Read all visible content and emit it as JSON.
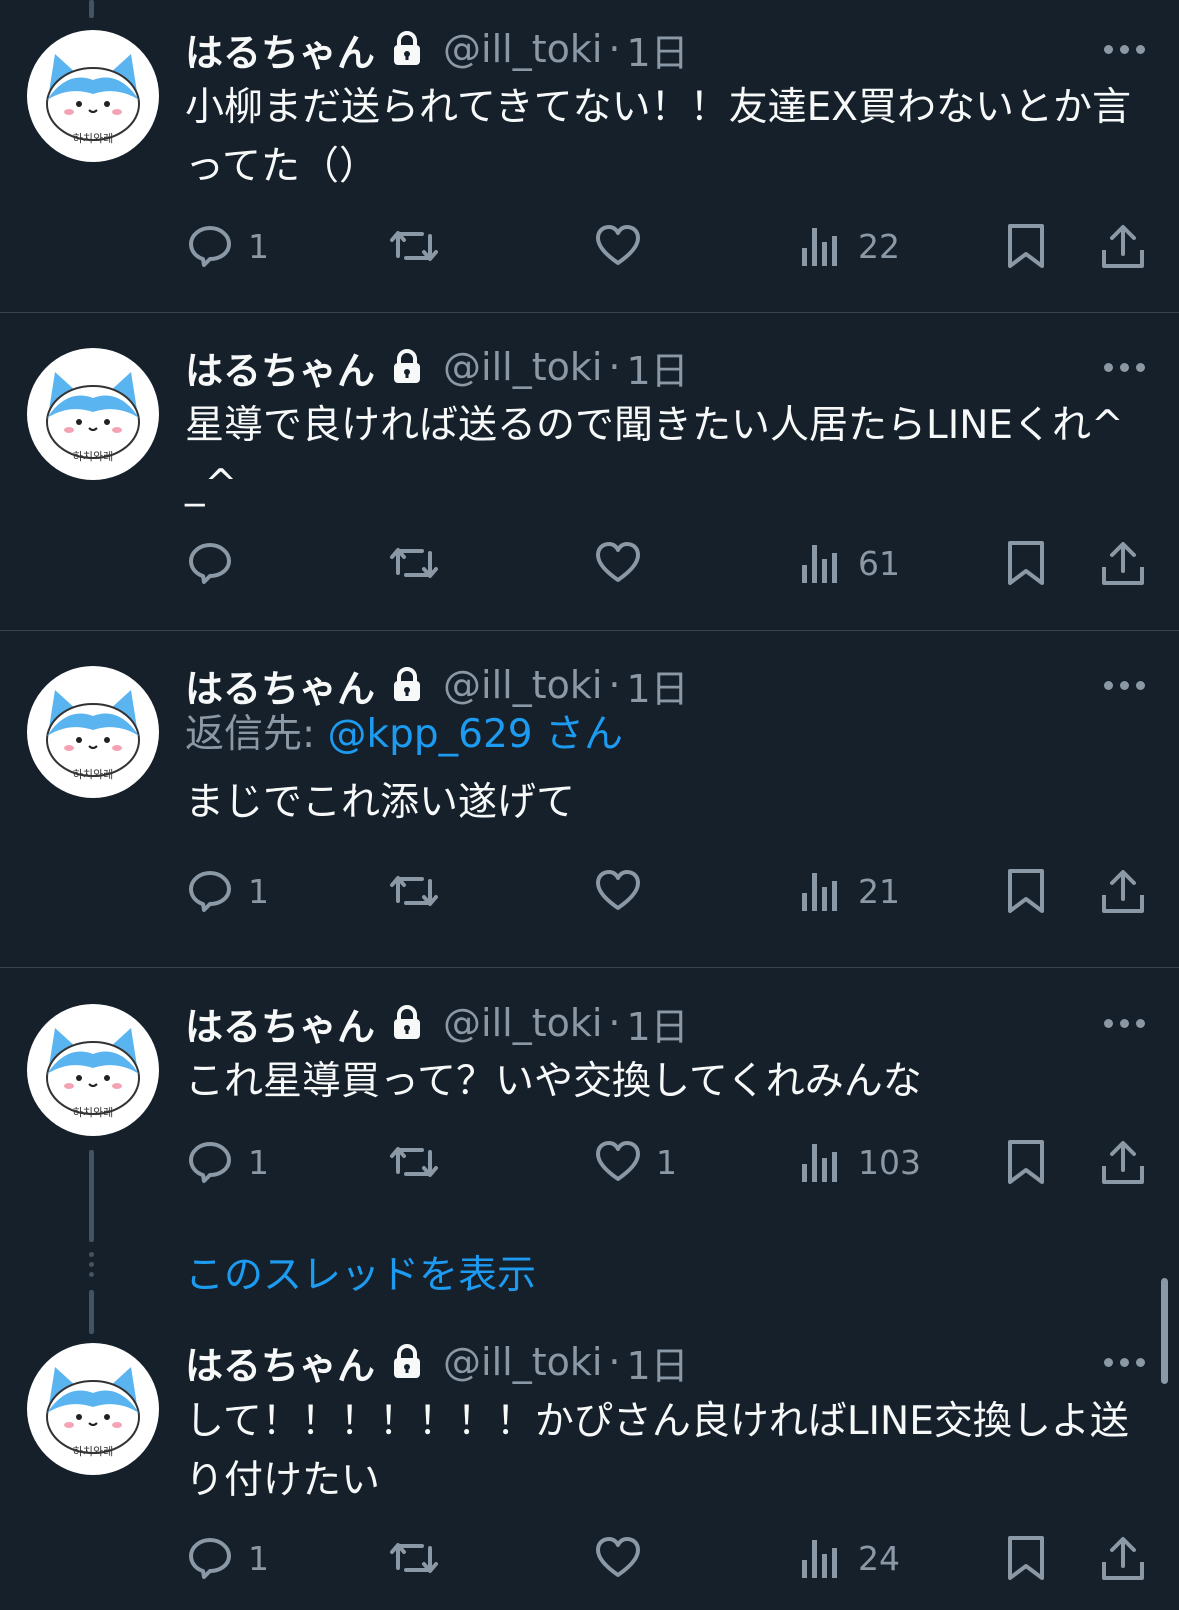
{
  "user": {
    "name": "はるちゃん",
    "handle": "@ill_toki",
    "separator": "·",
    "avatar_caption": "하치와레"
  },
  "colors": {
    "background": "#15202b",
    "text": "#f7f9f9",
    "secondary": "#8b98a5",
    "accent": "#1d9bf0",
    "divider": "#38444d"
  },
  "icons": {
    "reply": "reply-icon",
    "retweet": "retweet-icon",
    "like": "heart-icon",
    "views": "views-icon",
    "bookmark": "bookmark-icon",
    "share": "share-icon",
    "more": "more-icon",
    "lock": "lock-icon"
  },
  "tweets": [
    {
      "time": "1日",
      "text": "小柳まだ送られてきてない！！友達EX買わないとか言ってた（）",
      "reply_count": "1",
      "like_count": "",
      "view_count": "22"
    },
    {
      "time": "1日",
      "text": "星導で良ければ送るので聞きたい人居たらLINEくれ^_^",
      "reply_count": "",
      "like_count": "",
      "view_count": "61"
    },
    {
      "time": "1日",
      "reply_prefix": "返信先: ",
      "reply_mention": "@kpp_629 さん",
      "text": "まじでこれ添い遂げて",
      "reply_count": "1",
      "like_count": "",
      "view_count": "21"
    },
    {
      "time": "1日",
      "text": "これ星導買って？いや交換してくれみんな",
      "reply_count": "1",
      "like_count": "1",
      "view_count": "103"
    },
    {
      "time": "1日",
      "text": "して！！！！！！！かぴさん良ければLINE交換しよ送り付けたい",
      "reply_count": "1",
      "like_count": "",
      "view_count": "24"
    }
  ],
  "show_thread_label": "このスレッドを表示"
}
